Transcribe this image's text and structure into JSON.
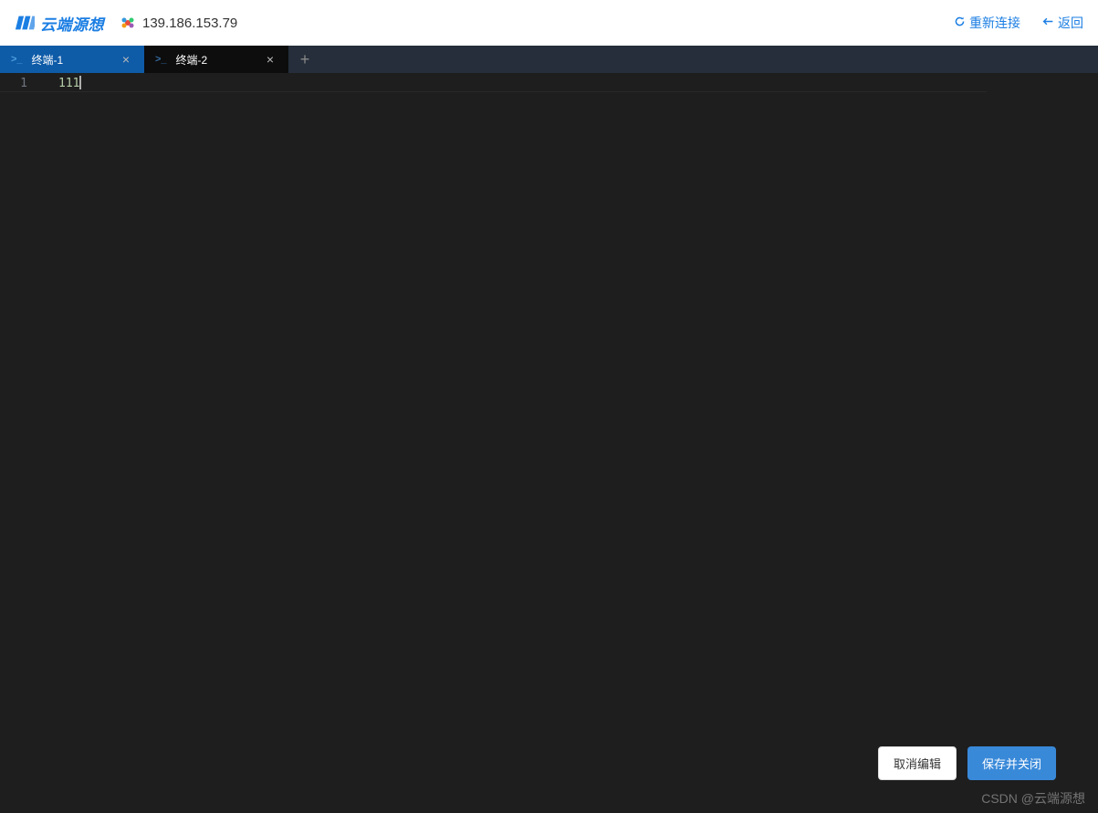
{
  "header": {
    "logo_text": "云端源想",
    "server_ip": "139.186.153.79",
    "reconnect_label": "重新连接",
    "back_label": "返回"
  },
  "tabs": [
    {
      "label": "终端-1",
      "active": true
    },
    {
      "label": "终端-2",
      "active": false
    }
  ],
  "editor": {
    "lines": [
      {
        "number": "1",
        "content": "111"
      }
    ]
  },
  "footer": {
    "cancel_label": "取消编辑",
    "save_label": "保存并关闭"
  },
  "watermark": "CSDN @云端源想"
}
